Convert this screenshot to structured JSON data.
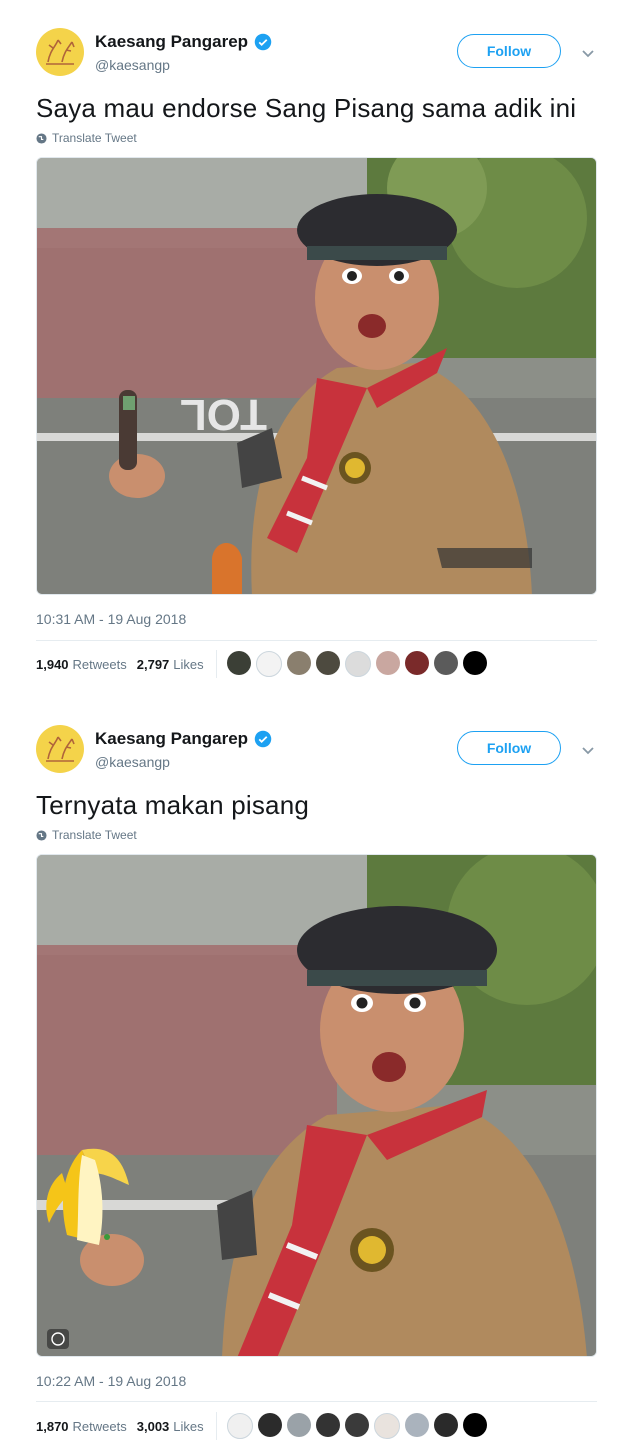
{
  "tweets": [
    {
      "author_name": "Kaesang Pangarep",
      "handle": "@kaesangp",
      "follow_label": "Follow",
      "text": "Saya mau endorse Sang Pisang sama adik ini",
      "translate_label": "Translate Tweet",
      "timestamp": "10:31 AM - 19 Aug 2018",
      "retweets_count": "1,940",
      "retweets_label": "Retweets",
      "likes_count": "2,797",
      "likes_label": "Likes",
      "photo_desc_icon": "photo",
      "liker_colors": [
        "#3b3f36",
        "#f3f3f3",
        "#8a7f6e",
        "#4d4a3f",
        "#dcdcdc",
        "#c9a7a0",
        "#7a2a2a",
        "#5b5b5b",
        "#000000"
      ]
    },
    {
      "author_name": "Kaesang Pangarep",
      "handle": "@kaesangp",
      "follow_label": "Follow",
      "text": "Ternyata makan pisang",
      "translate_label": "Translate Tweet",
      "timestamp": "10:22 AM - 19 Aug 2018",
      "retweets_count": "1,870",
      "retweets_label": "Retweets",
      "likes_count": "3,003",
      "likes_label": "Likes",
      "photo_desc_icon": "photo",
      "liker_colors": [
        "#f0f0f0",
        "#2b2b2b",
        "#9aa2a8",
        "#333333",
        "#3a3a3a",
        "#e9e3de",
        "#aab3bd",
        "#2a2a2a",
        "#000000"
      ]
    }
  ],
  "colors": {
    "accent": "#1da1f2",
    "muted": "#657786",
    "avatar_bg": "#f4d34a"
  },
  "icons": [
    "verified-icon",
    "chevron-down-icon",
    "globe-icon",
    "emoji-icon",
    "banana-icon"
  ]
}
